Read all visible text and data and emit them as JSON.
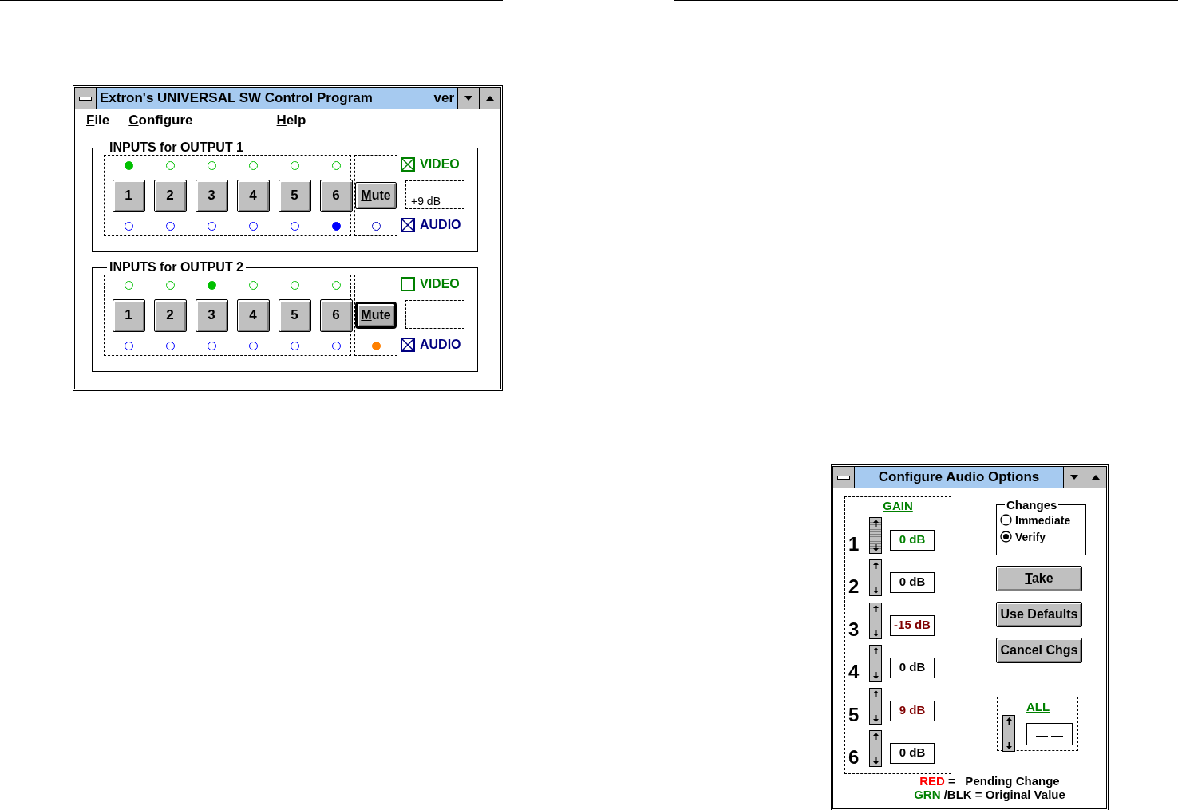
{
  "main_window": {
    "title": "Extron's UNIVERSAL SW Control Program",
    "title_tail": "ver",
    "menu": [
      {
        "label": "File"
      },
      {
        "label": "Configure"
      },
      {
        "label": "Help"
      }
    ],
    "outputs": [
      {
        "title": "INPUTS for OUTPUT 1",
        "video_leds": [
          {
            "selected": true
          },
          {
            "selected": false
          },
          {
            "selected": false
          },
          {
            "selected": false
          },
          {
            "selected": false
          },
          {
            "selected": false
          }
        ],
        "inputs": [
          "1",
          "2",
          "3",
          "4",
          "5",
          "6"
        ],
        "audio_leds": [
          {
            "selected": false
          },
          {
            "selected": false
          },
          {
            "selected": false
          },
          {
            "selected": false
          },
          {
            "selected": false
          },
          {
            "selected": true
          }
        ],
        "mute": {
          "label": "Mute",
          "focused": false,
          "lit": false
        },
        "video": {
          "label": "VIDEO",
          "checked": true
        },
        "audio": {
          "label": "AUDIO",
          "checked": true
        },
        "gain_readout": "+9 dB"
      },
      {
        "title": "INPUTS for OUTPUT 2",
        "video_leds": [
          {
            "selected": false
          },
          {
            "selected": false
          },
          {
            "selected": true
          },
          {
            "selected": false
          },
          {
            "selected": false
          },
          {
            "selected": false
          }
        ],
        "inputs": [
          "1",
          "2",
          "3",
          "4",
          "5",
          "6"
        ],
        "audio_leds": [
          {
            "selected": false
          },
          {
            "selected": false
          },
          {
            "selected": false
          },
          {
            "selected": false
          },
          {
            "selected": false
          },
          {
            "selected": false
          }
        ],
        "mute": {
          "label": "Mute",
          "focused": true,
          "lit": true
        },
        "video": {
          "label": "VIDEO",
          "checked": false
        },
        "audio": {
          "label": "AUDIO",
          "checked": true
        }
      }
    ]
  },
  "audio_window": {
    "title": "Configure Audio Options",
    "gain_heading": "GAIN",
    "channels": [
      {
        "number": "1",
        "value": "0 dB",
        "color": "#008000",
        "focused": true
      },
      {
        "number": "2",
        "value": "0 dB",
        "color": "#000000",
        "focused": false
      },
      {
        "number": "3",
        "value": "-15 dB",
        "color": "#800000",
        "focused": false
      },
      {
        "number": "4",
        "value": "0 dB",
        "color": "#000000",
        "focused": false
      },
      {
        "number": "5",
        "value": "9 dB",
        "color": "#800000",
        "focused": false
      },
      {
        "number": "6",
        "value": "0 dB",
        "color": "#000000",
        "focused": false
      }
    ],
    "changes": {
      "title": "Changes",
      "options": [
        {
          "label": "Immediate",
          "selected": false
        },
        {
          "label": "Verify",
          "selected": true
        }
      ]
    },
    "buttons": [
      {
        "label": "Take",
        "mnemonic": true
      },
      {
        "label": "Use Defaults",
        "mnemonic": false
      },
      {
        "label": "Cancel Chgs",
        "mnemonic": false
      }
    ],
    "all": {
      "label": "ALL",
      "value": "— —"
    },
    "legend": [
      {
        "key": "RED",
        "color": "#ff0000",
        "rest": "=   Pending Change"
      },
      {
        "key": "GRN",
        "color": "#008000",
        "rest": "/BLK = Original Value"
      }
    ]
  }
}
